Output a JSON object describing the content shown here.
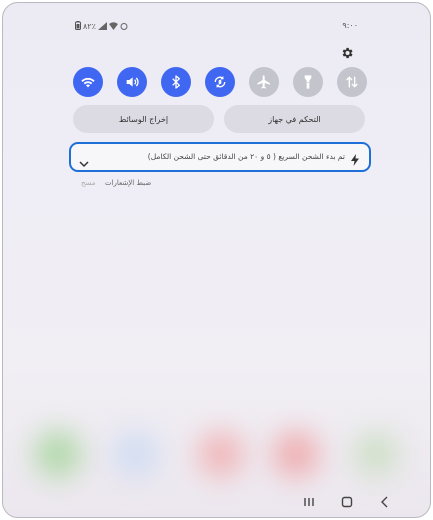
{
  "status_bar": {
    "left_text": "٨٢٪",
    "time": "٩:٠٠"
  },
  "quick_tiles": [
    {
      "name": "wifi",
      "state": "on",
      "icon": "wifi-icon"
    },
    {
      "name": "sound",
      "state": "on",
      "icon": "speaker-icon"
    },
    {
      "name": "bluetooth",
      "state": "on",
      "icon": "bluetooth-icon"
    },
    {
      "name": "auto-rotate",
      "state": "on",
      "icon": "rotate-icon"
    },
    {
      "name": "airplane",
      "state": "off",
      "icon": "airplane-icon"
    },
    {
      "name": "flashlight",
      "state": "off",
      "icon": "flashlight-icon"
    },
    {
      "name": "mobile-data",
      "state": "off",
      "icon": "data-arrows-icon"
    }
  ],
  "pills": {
    "media_output": "إخراج الوسائط",
    "device_control": "التحكم في جهاز"
  },
  "notification": {
    "text": "تم بدء الشحن السريع ( ٥ و ٢٠ من الدقائق حتى الشحن الكامل)",
    "icon": "lightning-bolt-icon"
  },
  "notification_footer": {
    "settings_label": "ضبط الإشعارات",
    "clear_label": "مسح"
  },
  "colors": {
    "accent": "#3f67f2",
    "tile_off": "#c3c4cc",
    "highlight_border": "#1f6fd8"
  },
  "navbar": {
    "recents": "recents-icon",
    "home": "home-icon",
    "back": "back-icon"
  }
}
